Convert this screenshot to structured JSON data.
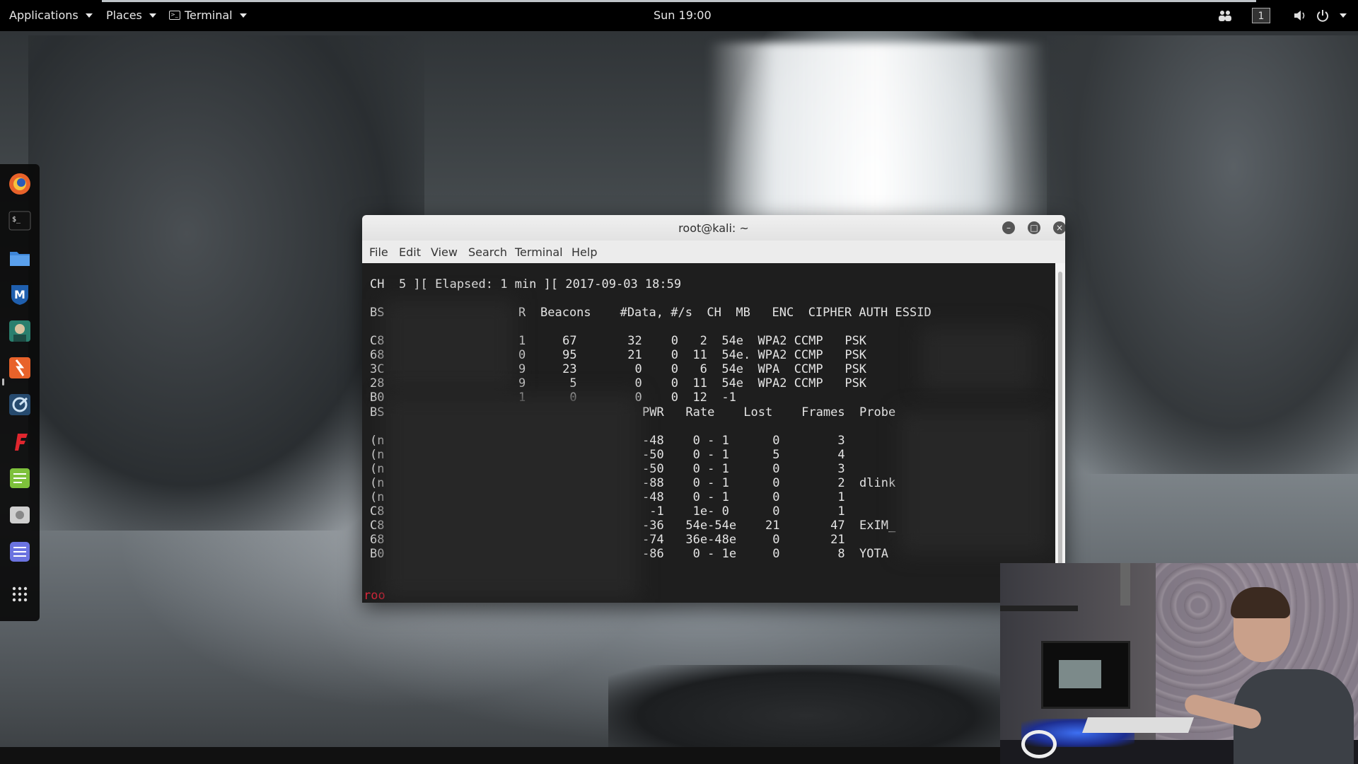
{
  "topbar": {
    "applications_label": "Applications",
    "places_label": "Places",
    "terminal_label": "Terminal",
    "clock": "Sun 19:00",
    "workspace": "1"
  },
  "dock": {
    "items": [
      {
        "name": "firefox",
        "icon": "firefox-icon"
      },
      {
        "name": "terminal",
        "icon": "terminal-icon"
      },
      {
        "name": "files",
        "icon": "folder-icon"
      },
      {
        "name": "metasploit",
        "icon": "metasploit-icon"
      },
      {
        "name": "armitage",
        "icon": "armitage-icon"
      },
      {
        "name": "burpsuite",
        "icon": "burpsuite-icon"
      },
      {
        "name": "maltego",
        "icon": "maltego-icon"
      },
      {
        "name": "faraday",
        "icon": "faraday-icon"
      },
      {
        "name": "leafpad",
        "icon": "text-editor-icon"
      },
      {
        "name": "cutycapt",
        "icon": "screenshot-icon"
      },
      {
        "name": "notes",
        "icon": "notes-icon"
      },
      {
        "name": "show-apps",
        "icon": "app-grid-icon"
      }
    ]
  },
  "terminal": {
    "title": "root@kali: ~",
    "menu": [
      "File",
      "Edit",
      "View",
      "Search",
      "Terminal",
      "Help"
    ],
    "status_line": "CH  5 ][ Elapsed: 1 min ][ 2017-09-03 18:59",
    "ap_header": {
      "left": "BS",
      "pwr_tail": "R",
      "right": "Beacons    #Data, #/s  CH  MB   ENC  CIPHER AUTH ESSID"
    },
    "ap_rows": [
      {
        "left": "C8",
        "pwr": "1",
        "rest": "     67       32    0   2  54e  WPA2 CCMP   PSK"
      },
      {
        "left": "68",
        "pwr": "0",
        "rest": "     95       21    0  11  54e. WPA2 CCMP   PSK"
      },
      {
        "left": "3C",
        "pwr": "9",
        "rest": "     23        0    0   6  54e  WPA  CCMP   PSK"
      },
      {
        "left": "28",
        "pwr": "9",
        "rest": "      5        0    0  11  54e  WPA2 CCMP   PSK"
      },
      {
        "left": "B0",
        "pwr": "1",
        "rest": "      0        0    0  12  -1"
      }
    ],
    "client_header": {
      "left": "BS",
      "right": "PWR   Rate    Lost    Frames  Probe"
    },
    "client_rows": [
      {
        "left": "(n",
        "rest": "-48    0 - 1      0        3"
      },
      {
        "left": "(n",
        "rest": "-50    0 - 1      5        4"
      },
      {
        "left": "(n",
        "rest": "-50    0 - 1      0        3"
      },
      {
        "left": "(n",
        "rest": "-88    0 - 1      0        2  dlink"
      },
      {
        "left": "(n",
        "rest": "-48    0 - 1      0        1"
      },
      {
        "left": "C8",
        "rest": " -1    1e- 0      0        1"
      },
      {
        "left": "C8",
        "rest": "-36   54e-54e    21       47  ExIM_"
      },
      {
        "left": "68",
        "rest": "-74   36e-48e     0       21"
      },
      {
        "left": "B0",
        "rest": "-86    0 - 1e     0        8  YOTA"
      }
    ],
    "prompt": "roo"
  },
  "colors": {
    "terminal_bg": "#1e1e1e",
    "terminal_fg": "#e4e4e4",
    "prompt_red": "#e0263b",
    "topbar_bg": "#000000"
  }
}
